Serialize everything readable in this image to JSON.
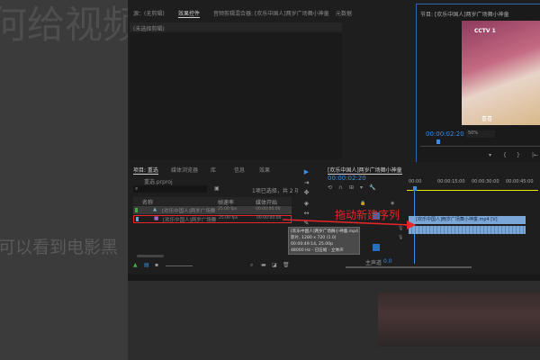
{
  "background": {
    "heading_fragment": "何给视频添",
    "caption_fragment": "可以看到电影黑"
  },
  "source_panel": {
    "tabs": [
      "源：(无剪辑)",
      "效果控件",
      "音频剪辑混合器: [欢乐中国人]两岁广场舞小神童",
      "元数据"
    ],
    "active_tab": "效果控件",
    "empty_label": "(未选择剪辑)"
  },
  "program_monitor": {
    "title": "节目: [欢乐中国人]两岁广场舞小神童",
    "timecode": "00:00:02:20",
    "zoom": "50%",
    "video_logo": "CCTV 1",
    "video_caption": "喜喜"
  },
  "project_panel": {
    "tabs": [
      "项目: 重选",
      "媒体浏览器",
      "库",
      "信息",
      "效果"
    ],
    "project_file": "重选.prproj",
    "selection_status": "1项已选择，共 2 项",
    "columns": [
      "名称",
      "帧速率",
      "媒体开始"
    ],
    "rows": [
      {
        "name": "[欢乐中国人]两岁广场舞",
        "fps": "25.00 fps",
        "start": "00:00:00:00"
      },
      {
        "name": "[欢乐中国人]两岁广场舞",
        "fps": "25.00 fps",
        "start": "00:00:00:00"
      }
    ]
  },
  "tooltip": {
    "lines": [
      "[欢乐中国人]两岁广场舞小神童.mp4",
      "影片, 1280 x 720 (1.0)",
      "00:00:49:14, 25.00p",
      "48000 Hz - 已压缩 - 立体声"
    ]
  },
  "timeline": {
    "title": "[欢乐中国人]两岁广场舞小神童",
    "timecode": "00:00:02:20",
    "ruler": [
      "00:00",
      "00:00:15:00",
      "00:00:30:00",
      "00:00:45:00"
    ],
    "video_clip": "[欢乐中国人]两岁广场舞小神童.mp4 [V]",
    "master_label": "主声道",
    "master_value": "0.0"
  },
  "annotation": {
    "text": "拖动新建序列",
    "color": "#e8262a"
  }
}
